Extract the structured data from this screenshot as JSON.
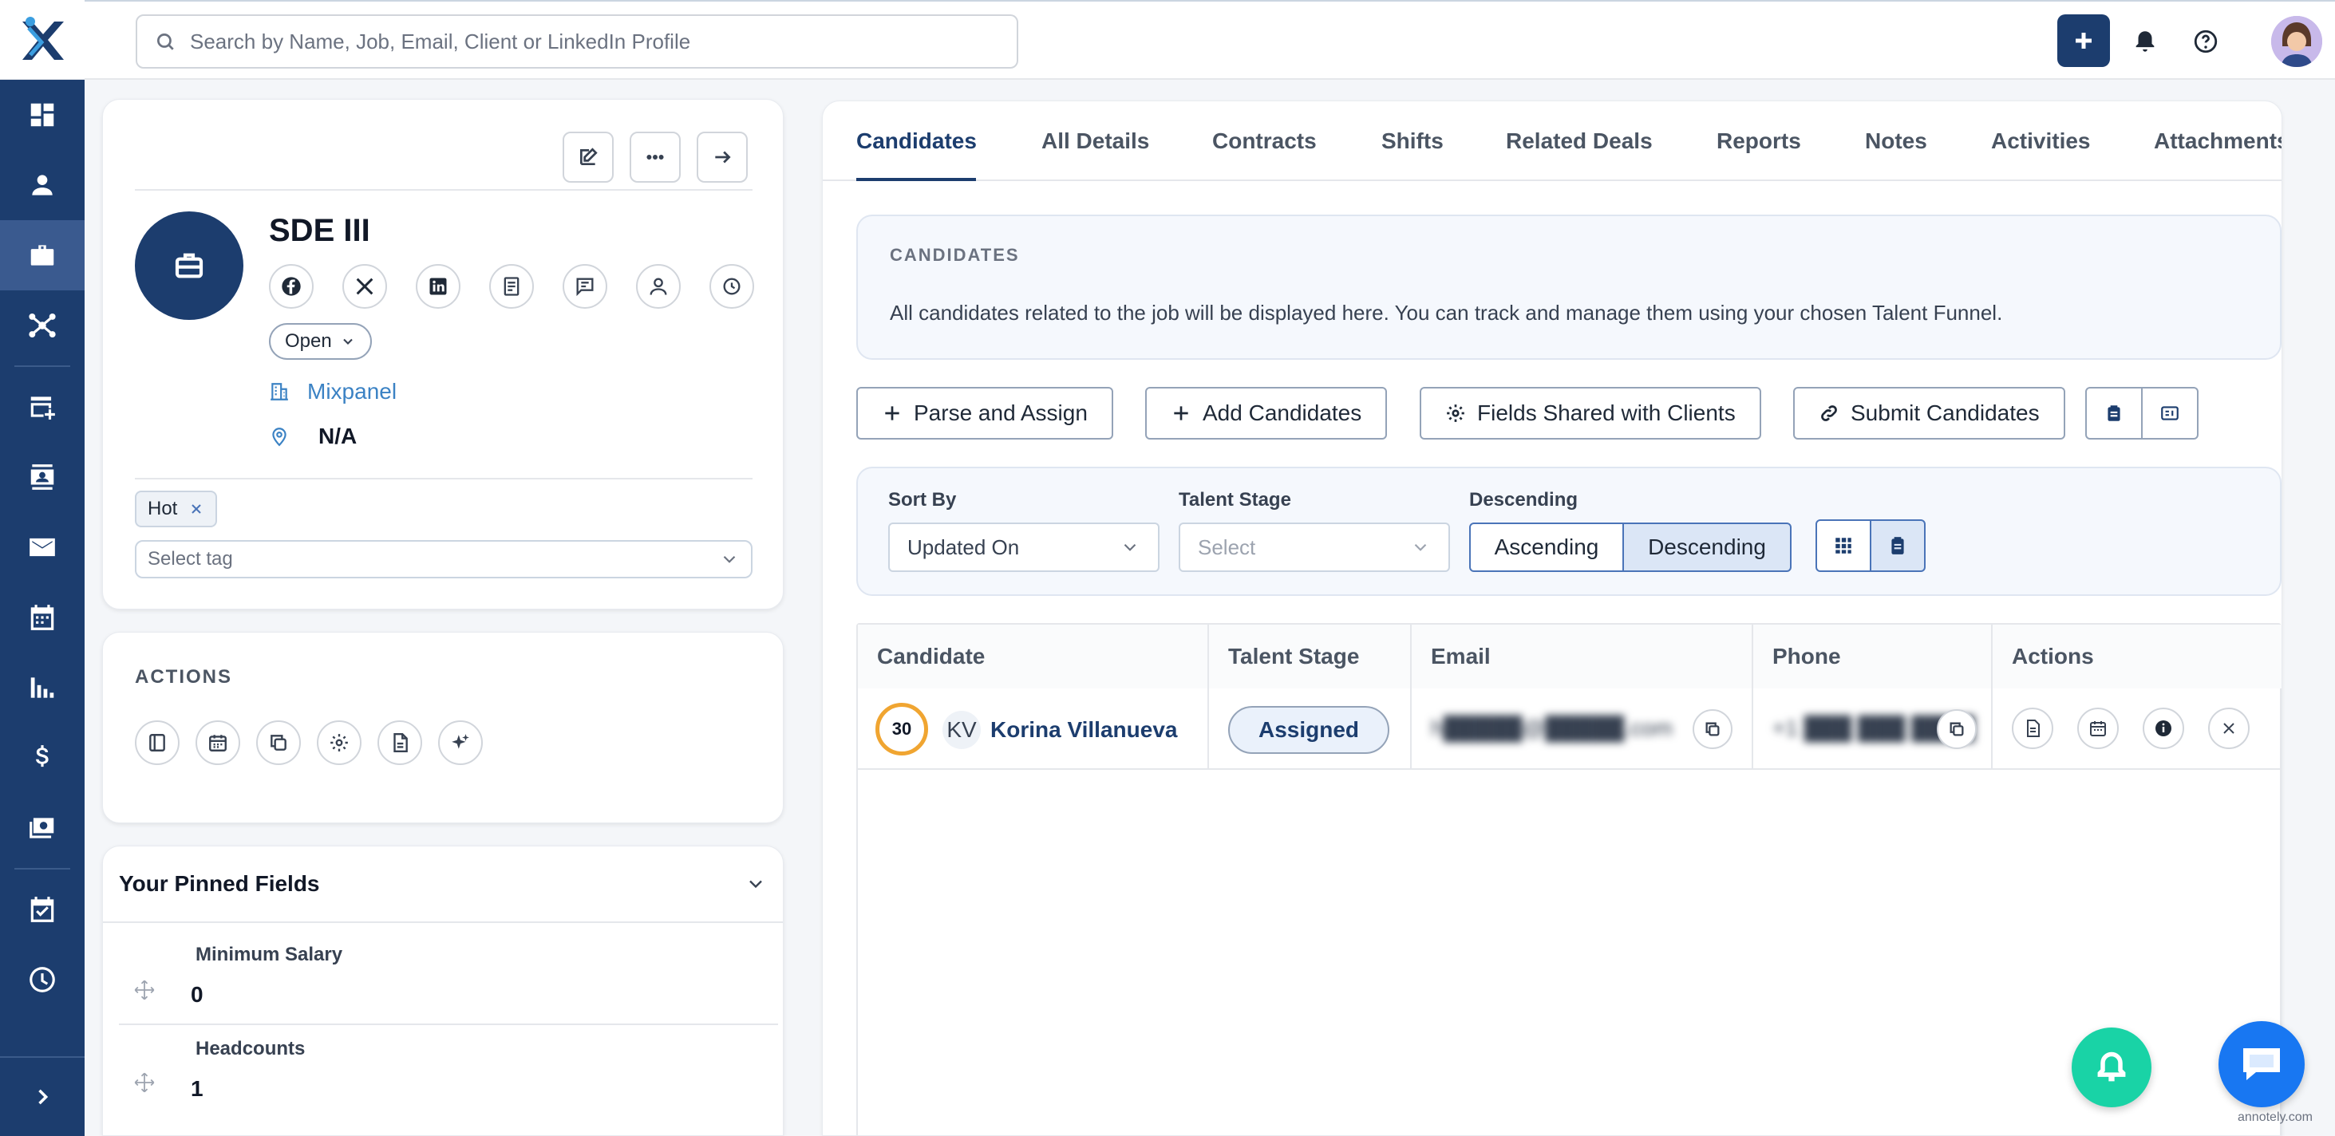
{
  "topbar": {
    "search_placeholder": "Search by Name, Job, Email, Client or LinkedIn Profile"
  },
  "sidebar": {
    "items": [
      "dashboard-icon",
      "candidates-icon",
      "jobs-icon",
      "network-icon",
      "store-add-icon",
      "contacts-icon",
      "mail-icon",
      "calendar-icon",
      "analytics-icon",
      "dollar-icon",
      "payroll-icon",
      "task-icon",
      "clock-icon"
    ],
    "active": "jobs-icon"
  },
  "job": {
    "title": "SDE III",
    "status": "Open",
    "client": "Mixpanel",
    "location": "N/A",
    "tags": [
      "Hot"
    ],
    "tag_placeholder": "Select tag"
  },
  "actions": {
    "label": "ACTIONS"
  },
  "pinned": {
    "title": "Your Pinned Fields",
    "fields": [
      {
        "label": "Minimum Salary",
        "value": "0"
      },
      {
        "label": "Headcounts",
        "value": "1"
      }
    ]
  },
  "tabs": [
    "Candidates",
    "All Details",
    "Contracts",
    "Shifts",
    "Related Deals",
    "Reports",
    "Notes",
    "Activities",
    "Attachments"
  ],
  "active_tab": "Candidates",
  "info": {
    "label": "CANDIDATES",
    "text": "All candidates related to the job will be displayed here. You can track and manage them using your chosen Talent Funnel."
  },
  "buttons": {
    "parse": "Parse and Assign",
    "add": "Add Candidates",
    "fields": "Fields Shared with Clients",
    "submit": "Submit Candidates"
  },
  "sort": {
    "sort_by_label": "Sort By",
    "sort_by_value": "Updated On",
    "stage_label": "Talent Stage",
    "stage_placeholder": "Select",
    "order_label": "Descending",
    "ascending": "Ascending",
    "descending": "Descending"
  },
  "table": {
    "columns": [
      "Candidate",
      "Talent Stage",
      "Email",
      "Phone",
      "Actions"
    ],
    "rows": [
      {
        "score": "30",
        "initials": "KV",
        "name": "Korina Villanueva",
        "stage": "Assigned",
        "email": "h█████@█████.com",
        "phone": "+1 ███ ███ ████"
      }
    ]
  },
  "watermark": "annotely.com",
  "colors": {
    "primary": "#1c3d6e",
    "accent_link": "#3b82c4",
    "score_ring": "#f0a531",
    "fab_bell": "#19d3a6",
    "fab_chat": "#1877f2"
  }
}
